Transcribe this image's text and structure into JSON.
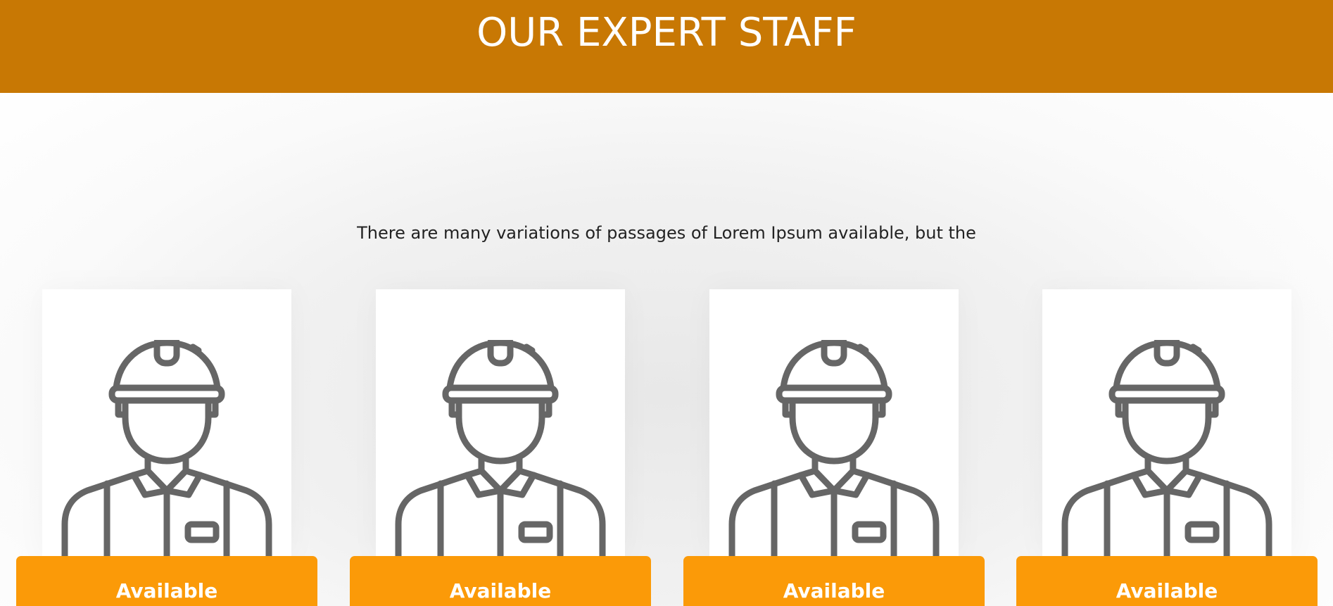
{
  "header": {
    "title": "OUR EXPERT STAFF",
    "background_color": "#c87804"
  },
  "intro": {
    "text": "There are many variations of passages of Lorem Ipsum available, but the"
  },
  "staff": {
    "icon": "construction-worker-icon",
    "accent_color": "#fb9a08",
    "members": [
      {
        "status_label": "Available"
      },
      {
        "status_label": "Available"
      },
      {
        "status_label": "Available"
      },
      {
        "status_label": "Available"
      }
    ]
  }
}
